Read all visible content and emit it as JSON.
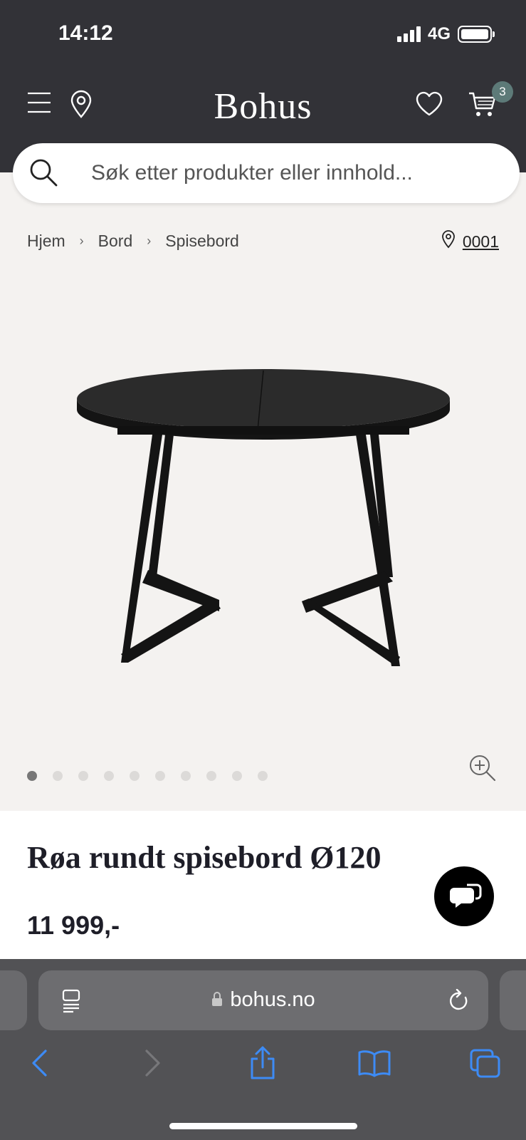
{
  "status": {
    "time": "14:12",
    "network": "4G"
  },
  "header": {
    "logo": "Bohus",
    "cart_count": "3",
    "icons": [
      "menu-icon",
      "location-pin-icon",
      "heart-icon",
      "cart-icon"
    ],
    "colors": {
      "header_bg": "#323237",
      "badge": "#5d7a78"
    }
  },
  "search": {
    "placeholder": "Søk etter produkter eller innhold..."
  },
  "breadcrumb": {
    "items": [
      "Hjem",
      "Bord",
      "Spisebord"
    ],
    "separator": "›"
  },
  "store": {
    "label": "0001"
  },
  "gallery": {
    "total_images": 10,
    "active_index": 0
  },
  "product": {
    "title": "Røa rundt spisebord Ø120",
    "price": "11 999,-"
  },
  "browser": {
    "url": "bohus.no"
  }
}
